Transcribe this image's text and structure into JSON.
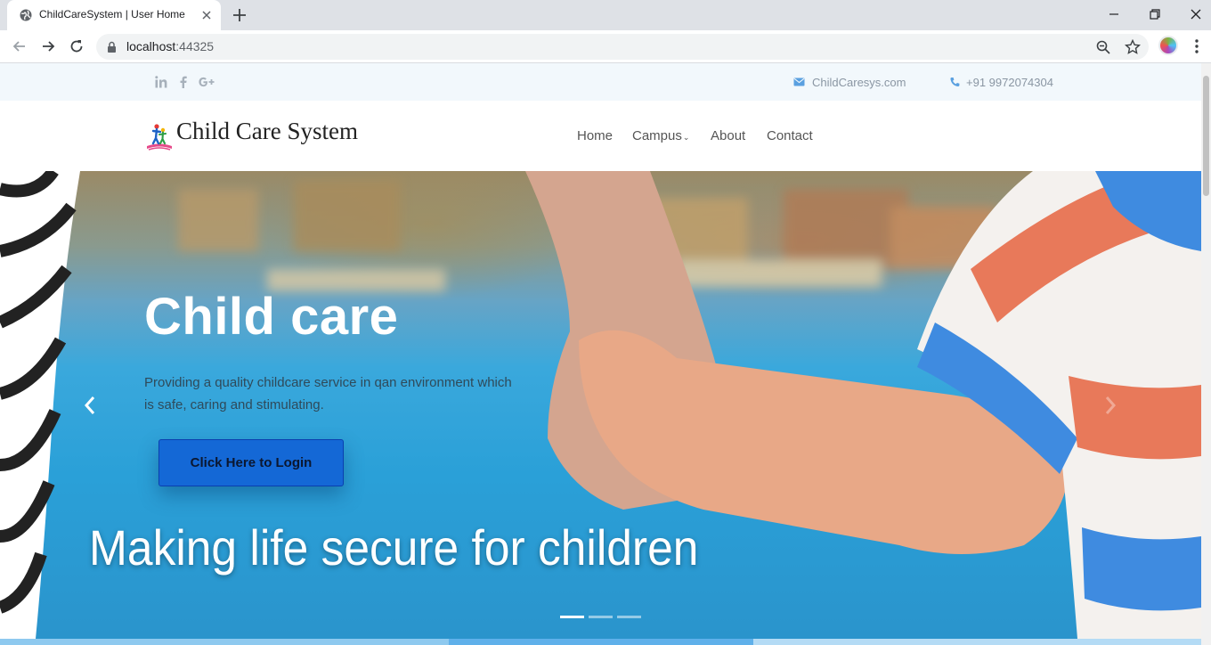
{
  "browser": {
    "tab_title": "ChildCareSystem | User Home",
    "url_host": "localhost",
    "url_port": ":44325"
  },
  "topbar": {
    "email": "ChildCaresys.com",
    "phone": "+91 9972074304",
    "social": [
      "linkedin-icon",
      "facebook-icon",
      "google-plus-icon"
    ]
  },
  "brand": {
    "name": "Child Care System"
  },
  "nav": {
    "items": [
      {
        "label": "Home"
      },
      {
        "label": "Campus",
        "has_dropdown": true,
        "caret": "⌄"
      },
      {
        "label": "About"
      },
      {
        "label": "Contact"
      }
    ]
  },
  "hero": {
    "title": "Child care",
    "description": "Providing a quality childcare service in qan environment which is safe, caring and stimulating.",
    "cta_label": "Click Here to Login",
    "tagline": "Making life secure for children",
    "slides": 3,
    "active_slide": 1
  },
  "colors": {
    "accent": "#1468d6",
    "topbar_bg": "#f2f8fc",
    "icon_blue": "#5aa0e0"
  }
}
